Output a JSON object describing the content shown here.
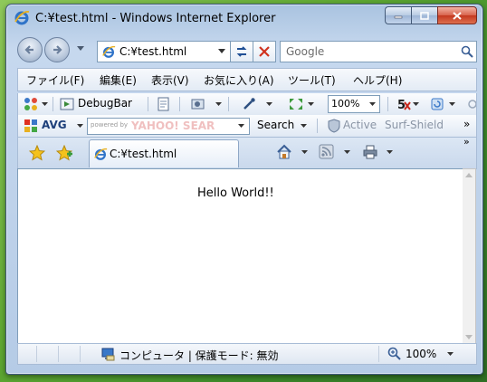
{
  "window": {
    "title": "C:¥test.html - Windows Internet Explorer"
  },
  "address": {
    "url": "C:¥test.html"
  },
  "search": {
    "placeholder": "Google"
  },
  "menu": {
    "items": [
      "ファイル(F)",
      "編集(E)",
      "表示(V)",
      "お気に入り(A)",
      "ツール(T)",
      "ヘルプ(H)"
    ]
  },
  "toolbar1": {
    "debugbar_label": "DebugBar",
    "zoom_value": "100%"
  },
  "toolbar2": {
    "avg_label": "AVG",
    "yahoo_powered": "powered by",
    "yahoo_brand": "YAHOO! SEAR",
    "search_label": "Search",
    "active_label": "Active",
    "surfshield_label": "Surf-Shield",
    "more": "»"
  },
  "tabs": {
    "active_label": "C:¥test.html",
    "more": "»"
  },
  "page": {
    "body_text": "Hello World!!"
  },
  "statusbar": {
    "zone_text": "コンピュータ | 保護モード: 無効",
    "zoom_text": "100%"
  }
}
